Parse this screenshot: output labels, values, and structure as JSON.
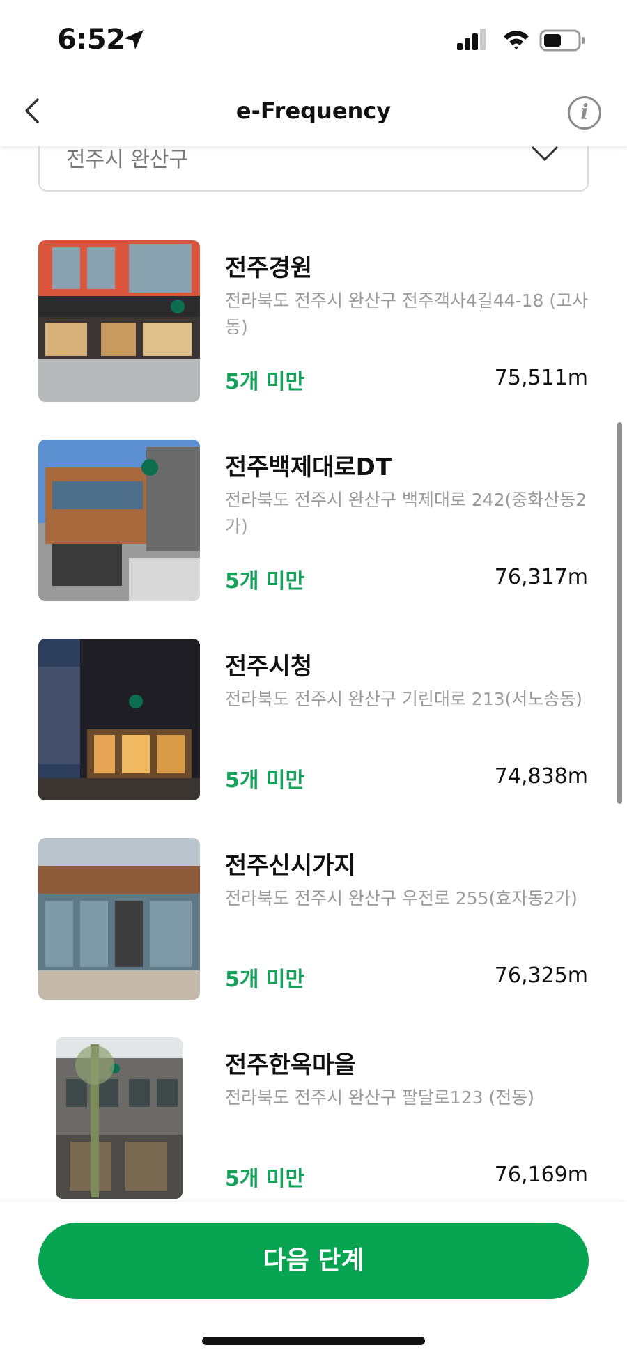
{
  "status_bar": {
    "time": "6:52"
  },
  "nav": {
    "title": "e-Frequency",
    "info_glyph": "i"
  },
  "region_select": {
    "value": "전주시 완산구"
  },
  "stores": [
    {
      "name": "전주경원",
      "address": "전라북도 전주시 완산구 전주객사4길44-18 (고사동)",
      "count": "5개 미만",
      "distance": "75,511m",
      "icon": "store-photo"
    },
    {
      "name": "전주백제대로DT",
      "address": "전라북도 전주시 완산구 백제대로 242(중화산동2가)",
      "count": "5개 미만",
      "distance": "76,317m",
      "icon": "store-photo"
    },
    {
      "name": "전주시청",
      "address": "전라북도 전주시 완산구 기린대로 213(서노송동)",
      "count": "5개 미만",
      "distance": "74,838m",
      "icon": "store-photo"
    },
    {
      "name": "전주신시가지",
      "address": "전라북도 전주시 완산구 우전로 255(효자동2가)",
      "count": "5개 미만",
      "distance": "76,325m",
      "icon": "store-photo"
    },
    {
      "name": "전주한옥마을",
      "address": "전라북도 전주시 완산구 팔달로123 (전동)",
      "count": "5개 미만",
      "distance": "76,169m",
      "icon": "store-photo"
    }
  ],
  "bottom": {
    "next_label": "다음 단계"
  },
  "colors": {
    "accent": "#07a552",
    "count_text": "#13a35a",
    "address_text": "#9a9a9a"
  }
}
